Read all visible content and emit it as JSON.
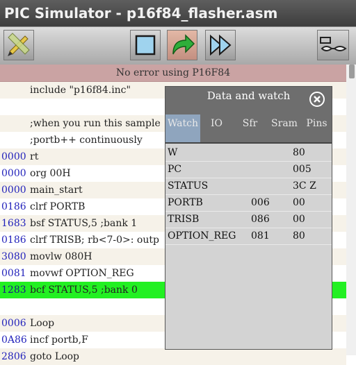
{
  "app": {
    "title": "PIC Simulator - p16f84_flasher.asm"
  },
  "toolbar": {
    "edit_icon": "pencil-ruler-icon",
    "stop_icon": "stop-icon",
    "step_icon": "step-arrow-icon",
    "run_icon": "fast-forward-icon",
    "watch_icon": "glasses-icon"
  },
  "status": {
    "message": "No error using P16F84"
  },
  "code": {
    "lines": [
      {
        "addr": "",
        "text": "include \"p16f84.inc\""
      },
      {
        "addr": "",
        "text": ""
      },
      {
        "addr": "",
        "text": ";when you run this sample"
      },
      {
        "addr": "",
        "text": ";portb++ continuously"
      },
      {
        "addr": "0000",
        "text": "rt"
      },
      {
        "addr": "0000",
        "text": "org 00H"
      },
      {
        "addr": "0000",
        "text": "main_start"
      },
      {
        "addr": "0186",
        "text": "clrf PORTB"
      },
      {
        "addr": "1683",
        "text": "bsf STATUS,5 ;bank 1"
      },
      {
        "addr": "0186",
        "text": "clrf TRISB; rb<7-0>: outp"
      },
      {
        "addr": "3080",
        "text": "movlw 080H"
      },
      {
        "addr": "0081",
        "text": "movwf OPTION_REG"
      },
      {
        "addr": "1283",
        "text": "bcf STATUS,5 ;bank 0"
      },
      {
        "addr": "",
        "text": ""
      },
      {
        "addr": "0006",
        "text": "Loop"
      },
      {
        "addr": "0A86",
        "text": "incf portb,F"
      },
      {
        "addr": "2806",
        "text": "goto Loop"
      }
    ],
    "highlighted_line": 12
  },
  "watch_panel": {
    "title": "Data and watch",
    "close_icon": "close-circle-icon",
    "tabs": [
      "Watch",
      "IO",
      "Sfr",
      "Sram",
      "Pins"
    ],
    "active_tab": "Watch",
    "rows": [
      {
        "name": "W",
        "addr": "",
        "value": "80"
      },
      {
        "name": "PC",
        "addr": "",
        "value": "005"
      },
      {
        "name": "STATUS",
        "addr": "",
        "value": "3C Z"
      },
      {
        "name": "PORTB",
        "addr": "006",
        "value": "00"
      },
      {
        "name": "TRISB",
        "addr": "086",
        "value": "00"
      },
      {
        "name": "OPTION_REG",
        "addr": "081",
        "value": "80"
      }
    ]
  },
  "colors": {
    "highlight": "#22f022",
    "status_bg": "#caa3a3",
    "address": "#2222bb",
    "active_tab": "#8fa5be"
  }
}
